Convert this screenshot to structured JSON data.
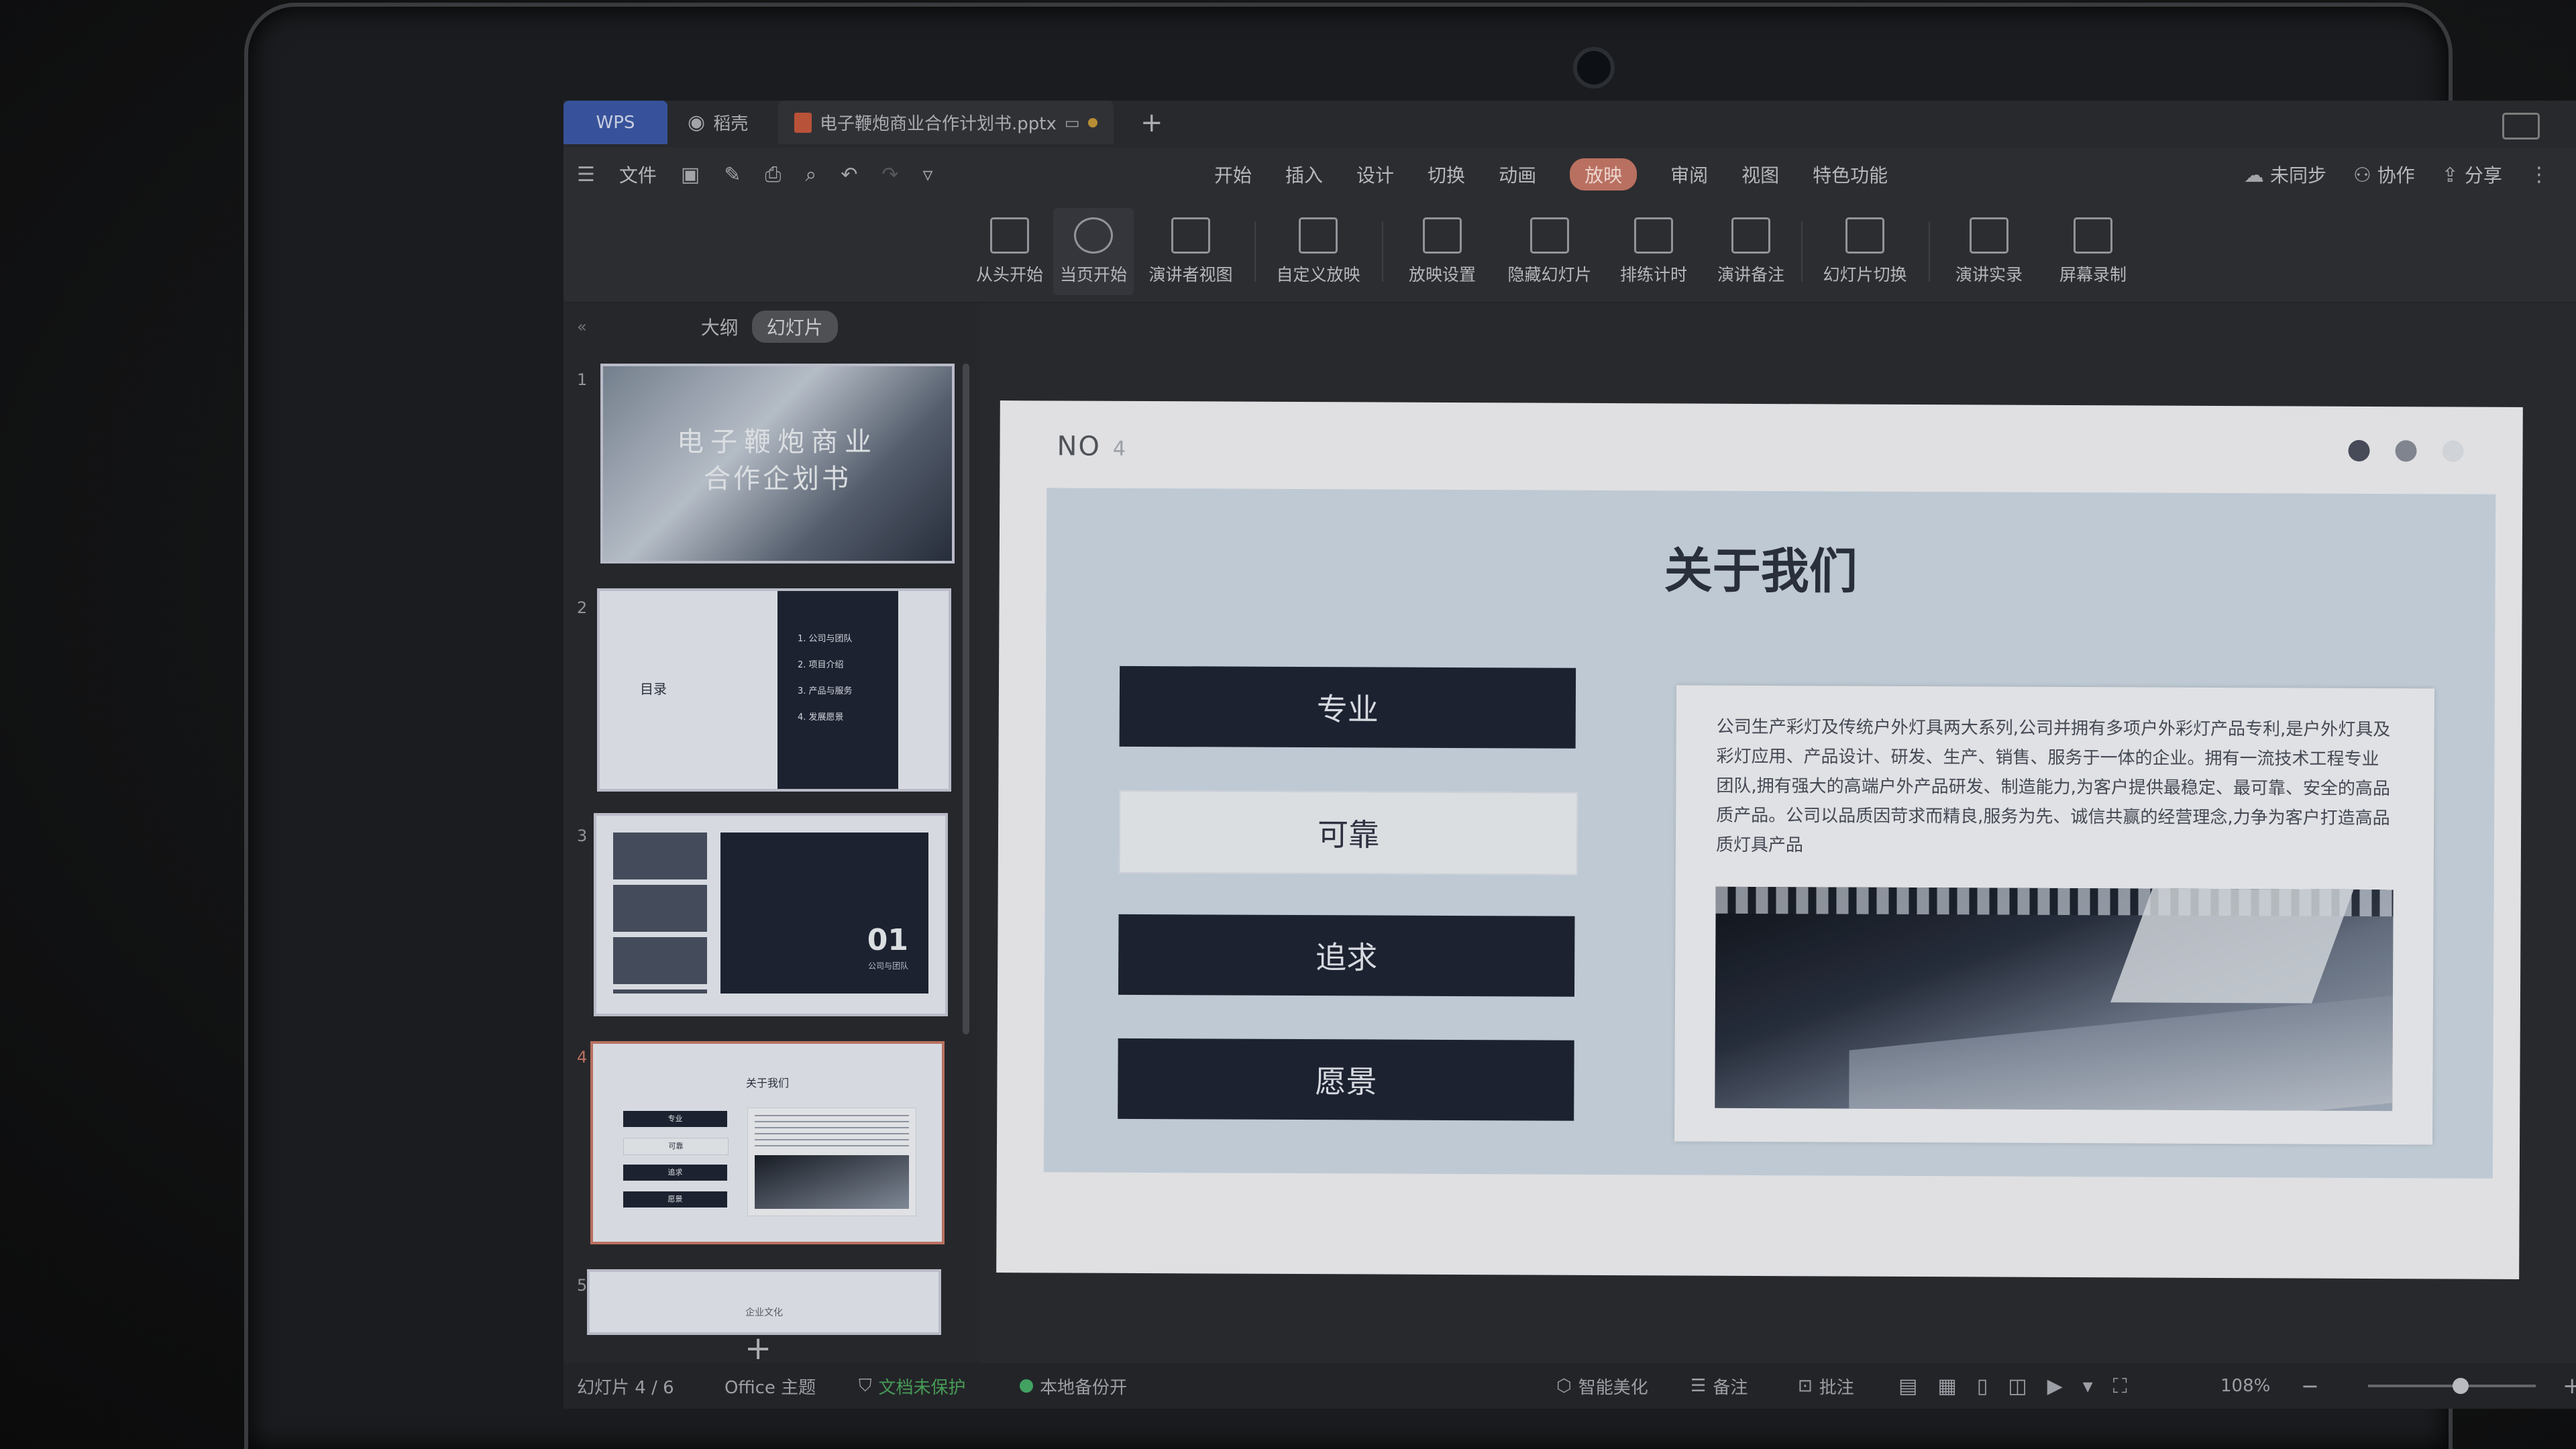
{
  "titlebar": {
    "wps": "WPS",
    "tab_docer": "稻壳",
    "tab_doc": "电子鞭炮商业合作计划书.pptx",
    "new_tab": "+"
  },
  "menubar": {
    "file": "文件",
    "tabs": [
      "开始",
      "插入",
      "设计",
      "切换",
      "动画",
      "放映",
      "审阅",
      "视图",
      "特色功能"
    ],
    "active_tab": "放映",
    "sync": "未同步",
    "collab": "协作",
    "share": "分享"
  },
  "ribbon": {
    "items": [
      "从头开始",
      "当页开始",
      "演讲者视图",
      "自定义放映",
      "放映设置",
      "隐藏幻灯片",
      "排练计时",
      "演讲备注",
      "幻灯片切换",
      "演讲实录",
      "屏幕录制"
    ]
  },
  "leftpanel": {
    "outline": "大纲",
    "slides": "幻灯片",
    "slide_numbers": [
      "1",
      "2",
      "3",
      "4",
      "5"
    ],
    "thumb1_title_a": "电子鞭炮商业",
    "thumb1_title_b": "合作企划书",
    "thumb2_label": "目录",
    "thumb2_items": [
      "1. 公司与团队",
      "2. 项目介绍",
      "3. 产品与服务",
      "4. 发展愿景"
    ],
    "thumb3_num": "01",
    "thumb3_sub": "公司与团队",
    "thumb4_title": "关于我们",
    "thumb4_buttons": [
      "专业",
      "可靠",
      "追求",
      "愿景"
    ],
    "thumb5_label": "企业文化",
    "add": "+"
  },
  "slide": {
    "no_label": "NO",
    "no_value": "4",
    "title": "关于我们",
    "buttons": [
      "专业",
      "可靠",
      "追求",
      "愿景"
    ],
    "description": "公司生产彩灯及传统户外灯具两大系列,公司并拥有多项户外彩灯产品专利,是户外灯具及彩灯应用、产品设计、研发、生产、销售、服务于一体的企业。拥有一流技术工程专业团队,拥有强大的高端户外产品研发、制造能力,为客户提供最稳定、最可靠、安全的高品质产品。公司以品质因苛求而精良,服务为先、诚信共赢的经营理念,力争为客户打造高品质灯具产品"
  },
  "statusbar": {
    "slide_count": "幻灯片 4 / 6",
    "theme": "Office 主题",
    "protect": "文档未保护",
    "backup": "本地备份开",
    "beautify": "智能美化",
    "notes": "备注",
    "comments": "批注",
    "zoom": "108%",
    "zoom_level": 0.55
  },
  "colors": {
    "accent": "#c97a69",
    "wps_blue": "#3c5aa8",
    "dark_button": "#1f2535",
    "slide_bg": "#cfdbe6",
    "green": "#47b06a"
  }
}
